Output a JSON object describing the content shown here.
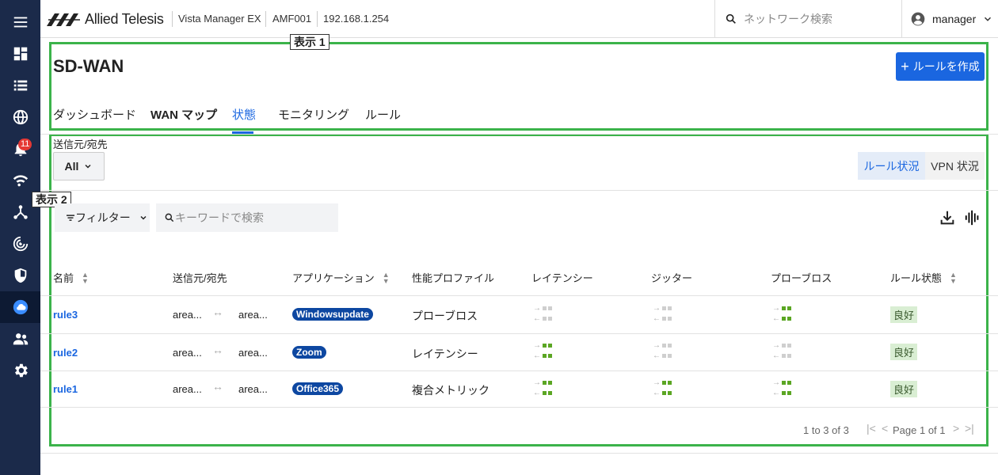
{
  "header": {
    "brand": "Allied Telesis",
    "product": "Vista Manager EX",
    "device": "AMF001",
    "ip": "192.168.1.254",
    "search_placeholder": "ネットワーク検索",
    "user": "manager"
  },
  "sidebar": {
    "bell_count": "11",
    "items": [
      "menu-icon",
      "dashboard-icon",
      "list-icon",
      "globe-icon",
      "bell-icon",
      "wifi-icon",
      "topology-icon",
      "radar-icon",
      "shield-icon",
      "cloud-icon",
      "users-icon",
      "settings-icon"
    ]
  },
  "annotations": {
    "label1": "表示 1",
    "label2": "表示 2"
  },
  "page": {
    "title": "SD-WAN",
    "create_button": "ルールを作成",
    "tabs": [
      {
        "label": "ダッシュボード"
      },
      {
        "label": "WAN マップ"
      },
      {
        "label": "状態"
      },
      {
        "label": "モニタリング"
      },
      {
        "label": "ルール"
      }
    ],
    "active_tab": "状態"
  },
  "filters": {
    "source_label": "送信元/宛先",
    "source_value": "All",
    "toggle_rule": "ルール状況",
    "toggle_vpn": "VPN 状況",
    "filter_button": "フィルター",
    "keyword_placeholder": "キーワードで検索"
  },
  "table": {
    "headers": [
      "名前",
      "送信元/宛先",
      "アプリケーション",
      "性能プロファイル",
      "レイテンシー",
      "ジッター",
      "プローブロス",
      "ルール状態"
    ],
    "rows": [
      {
        "name": "rule3",
        "src": "area...",
        "dst": "area...",
        "app": "Windowsupdate",
        "profile": "プローブロス",
        "latency": "gray",
        "jitter": "gray",
        "probe_loss": "green",
        "status": "良好"
      },
      {
        "name": "rule2",
        "src": "area...",
        "dst": "area...",
        "app": "Zoom",
        "profile": "レイテンシー",
        "latency": "green",
        "jitter": "gray",
        "probe_loss": "gray",
        "status": "良好"
      },
      {
        "name": "rule1",
        "src": "area...",
        "dst": "area...",
        "app": "Office365",
        "profile": "複合メトリック",
        "latency": "green",
        "jitter": "green",
        "probe_loss": "green",
        "status": "良好"
      }
    ]
  },
  "pagination": {
    "range": "1 to 3 of 3",
    "page": "Page 1 of 1"
  },
  "colors": {
    "accent": "#1a66e0",
    "sidebar": "#1b2a4a",
    "frame": "#3bb34a",
    "good": "#5ba623"
  }
}
